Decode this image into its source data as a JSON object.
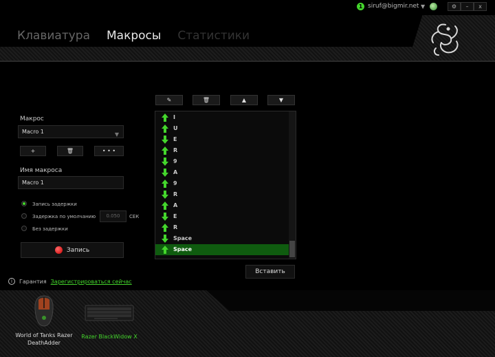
{
  "titlebar": {
    "badge": "1",
    "email": "siruf@bigmir.net",
    "dropdown": "▼",
    "settings": "⚙",
    "minimize": "–",
    "close": "x"
  },
  "tabs": [
    "Клавиатура",
    "Макросы",
    "Статистики"
  ],
  "macro": {
    "section_label": "Макрос",
    "selected": "Macro 1",
    "add": "+",
    "delete": "🗑",
    "more": "• • •",
    "name_label": "Имя макроса",
    "name_value": "Macro 1"
  },
  "delay": {
    "record_delay": "Запись задержки",
    "default_delay": "Задержка по умолчанию",
    "default_value": "0.050",
    "unit": "СЕК",
    "no_delay": "Без задержки",
    "selected": "record_delay"
  },
  "record_label": "Запись",
  "warranty": {
    "label": "Гарантия",
    "link": "Зарегистрироваться сейчас"
  },
  "list_toolbar": {
    "edit": "✎",
    "delete": "🗑",
    "up": "▲",
    "down": "▼"
  },
  "events": [
    {
      "dir": "up",
      "key": "I"
    },
    {
      "dir": "up",
      "key": "U"
    },
    {
      "dir": "down",
      "key": "E"
    },
    {
      "dir": "up",
      "key": "R"
    },
    {
      "dir": "down",
      "key": "9"
    },
    {
      "dir": "down",
      "key": "A"
    },
    {
      "dir": "up",
      "key": "9"
    },
    {
      "dir": "down",
      "key": "R"
    },
    {
      "dir": "up",
      "key": "A"
    },
    {
      "dir": "down",
      "key": "E"
    },
    {
      "dir": "up",
      "key": "R"
    },
    {
      "dir": "down",
      "key": "Space"
    },
    {
      "dir": "up",
      "key": "Space",
      "selected": true
    }
  ],
  "insert_label": "Вставить",
  "devices": [
    {
      "line1": "World of Tanks Razer",
      "line2": "DeathAdder",
      "active": false
    },
    {
      "line1": "Razer BlackWidow X",
      "line2": "",
      "active": true
    }
  ],
  "colors": {
    "accent": "#44d62c",
    "selected_row": "#0f5c0f",
    "record": "#e01010"
  }
}
